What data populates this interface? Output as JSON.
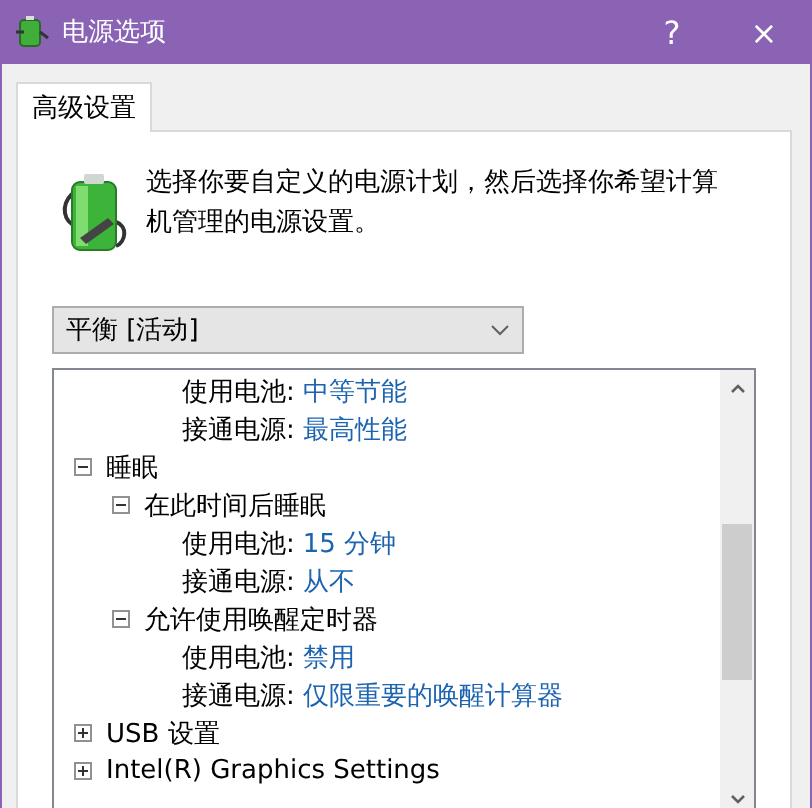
{
  "window": {
    "title": "电源选项",
    "help": "?",
    "close": "×"
  },
  "tabs": [
    {
      "label": "高级设置",
      "selected": true
    }
  ],
  "description": "选择你要自定义的电源计划，然后选择你希望计算机管理的电源设置。",
  "plan_dropdown": {
    "value": "平衡 [活动]"
  },
  "tree": [
    {
      "kind": "setting",
      "label": "使用电池:",
      "value": "中等节能"
    },
    {
      "kind": "setting",
      "label": "接通电源:",
      "value": "最高性能"
    },
    {
      "kind": "group",
      "label": "睡眠",
      "expanded": true,
      "children": [
        {
          "kind": "group",
          "label": "在此时间后睡眠",
          "expanded": true,
          "children": [
            {
              "kind": "setting",
              "label": "使用电池:",
              "value": "15 分钟"
            },
            {
              "kind": "setting",
              "label": "接通电源:",
              "value": "从不"
            }
          ]
        },
        {
          "kind": "group",
          "label": "允许使用唤醒定时器",
          "expanded": true,
          "children": [
            {
              "kind": "setting",
              "label": "使用电池:",
              "value": "禁用"
            },
            {
              "kind": "setting",
              "label": "接通电源:",
              "value": "仅限重要的唤醒计算器"
            }
          ]
        }
      ]
    },
    {
      "kind": "group",
      "label": "USB 设置",
      "expanded": false
    },
    {
      "kind": "group",
      "label": "Intel(R) Graphics Settings",
      "expanded": false
    }
  ]
}
